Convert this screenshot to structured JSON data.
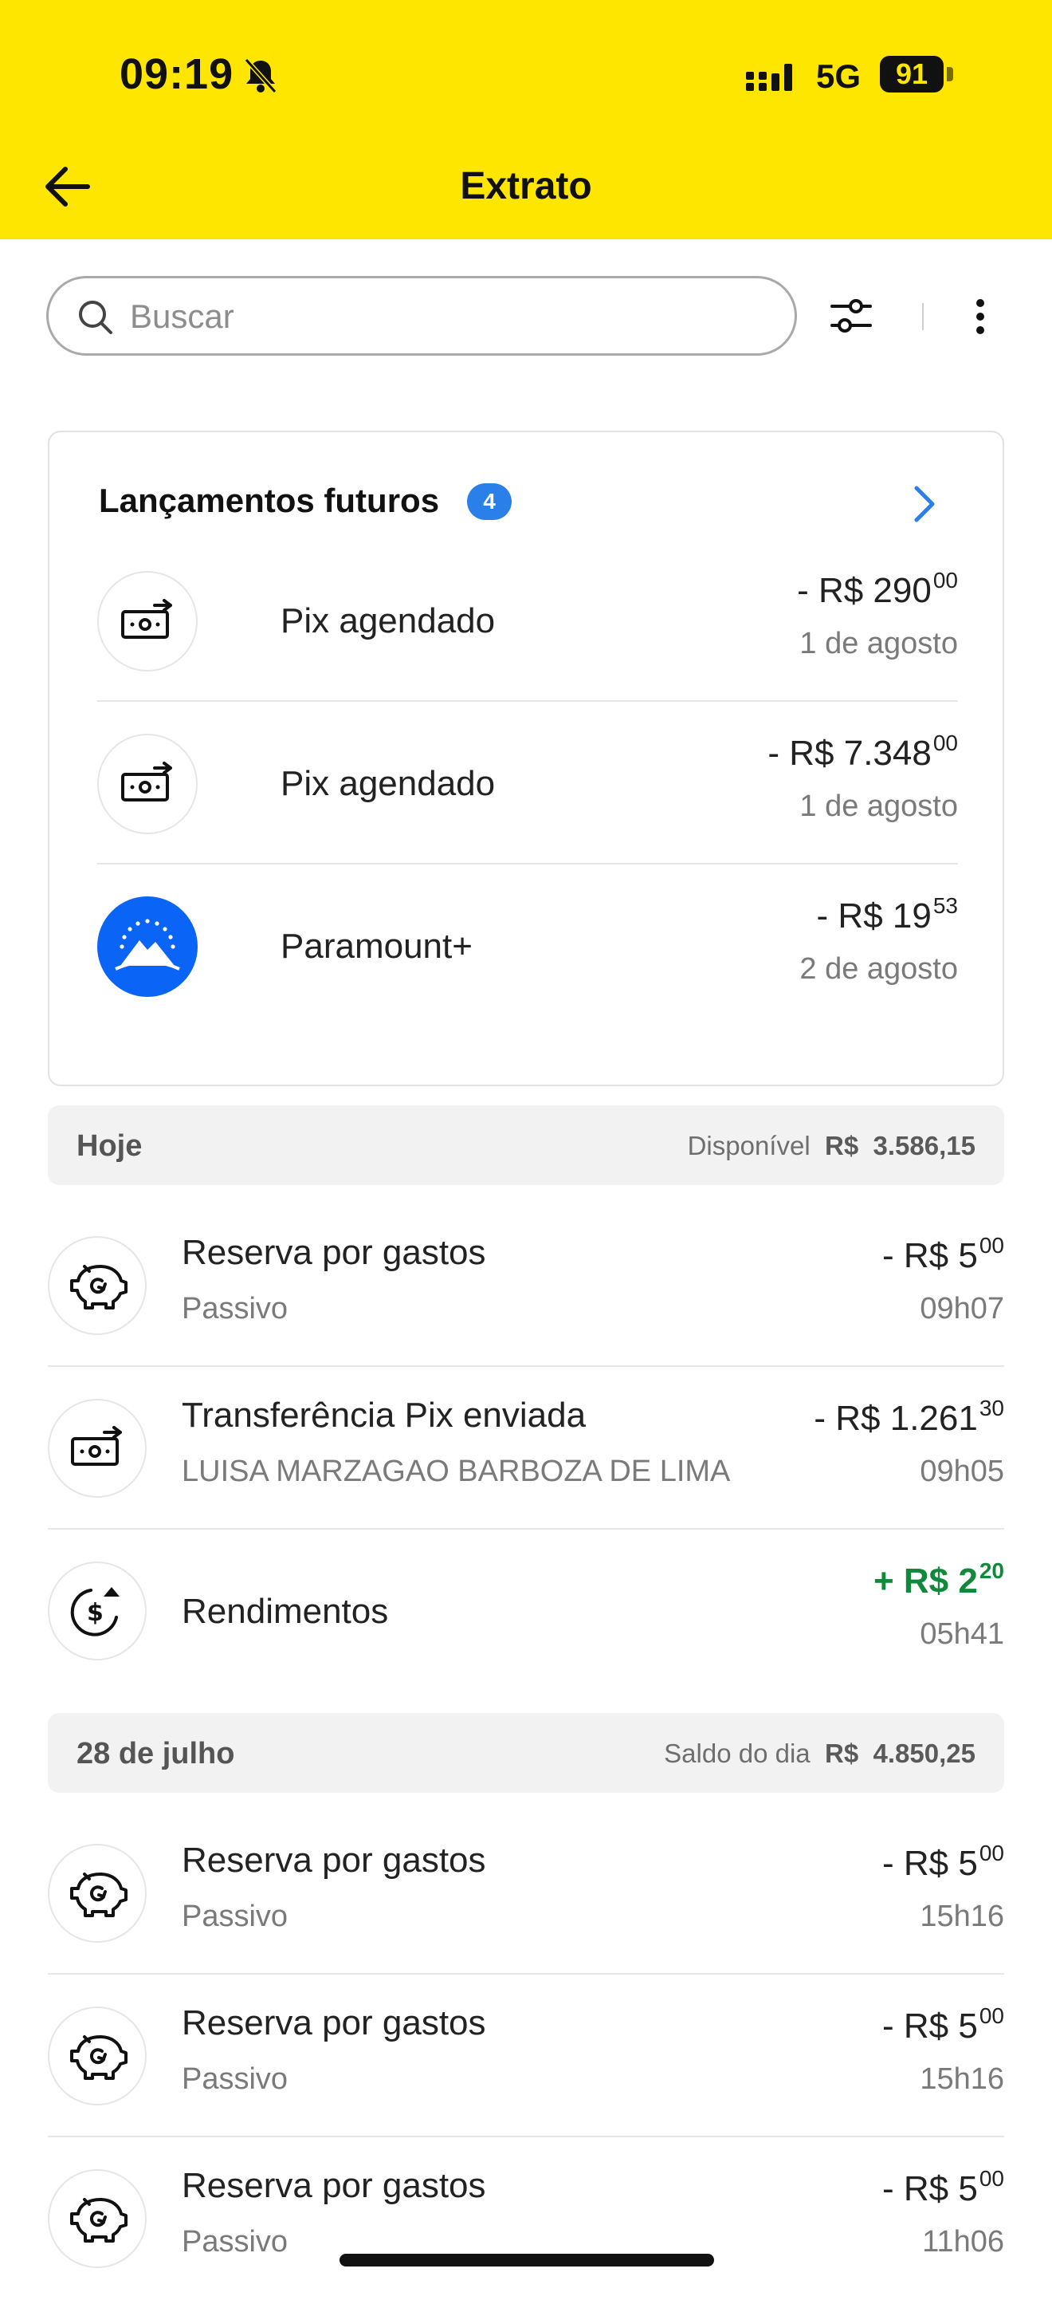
{
  "status_bar": {
    "time": "09:19",
    "network": "5G",
    "battery": "91"
  },
  "header": {
    "title": "Extrato"
  },
  "search": {
    "placeholder": "Buscar"
  },
  "future": {
    "title": "Lançamentos futuros",
    "count": "4",
    "items": [
      {
        "label": "Pix agendado",
        "amount": "- R$ 290",
        "cents": "00",
        "date": "1 de agosto",
        "icon": "scheduled-pix-icon"
      },
      {
        "label": "Pix agendado",
        "amount": "- R$ 7.348",
        "cents": "00",
        "date": "1 de agosto",
        "icon": "scheduled-pix-icon"
      },
      {
        "label": "Paramount+",
        "amount": "- R$ 19",
        "cents": "53",
        "date": "2 de agosto",
        "icon": "paramount-logo"
      }
    ]
  },
  "days": [
    {
      "name": "Hoje",
      "balance_label": "Disponível",
      "currency": "R$",
      "balance": "3.586,15",
      "transactions": [
        {
          "name": "Reserva por gastos",
          "sub": "Passivo",
          "amount": "- R$ 5",
          "cents": "00",
          "time": "09h07",
          "icon": "piggy-bank-icon"
        },
        {
          "name": "Transferência Pix enviada",
          "sub": "LUISA MARZAGAO BARBOZA DE LIMA",
          "amount": "- R$ 1.261",
          "cents": "30",
          "time": "09h05",
          "icon": "pix-transfer-icon"
        },
        {
          "name": "Rendimentos",
          "sub": "",
          "amount": "+ R$ 2",
          "cents": "20",
          "time": "05h41",
          "icon": "earnings-icon",
          "positive": true
        }
      ]
    },
    {
      "name": "28 de julho",
      "balance_label": "Saldo do dia",
      "currency": "R$",
      "balance": "4.850,25",
      "transactions": [
        {
          "name": "Reserva por gastos",
          "sub": "Passivo",
          "amount": "- R$ 5",
          "cents": "00",
          "time": "15h16",
          "icon": "piggy-bank-icon"
        },
        {
          "name": "Reserva por gastos",
          "sub": "Passivo",
          "amount": "- R$ 5",
          "cents": "00",
          "time": "15h16",
          "icon": "piggy-bank-icon"
        },
        {
          "name": "Reserva por gastos",
          "sub": "Passivo",
          "amount": "- R$ 5",
          "cents": "00",
          "time": "11h06",
          "icon": "piggy-bank-icon"
        }
      ]
    }
  ],
  "colors": {
    "brand_yellow": "#ffe600",
    "accent_blue": "#2a7fe8",
    "positive_green": "#12883c"
  }
}
